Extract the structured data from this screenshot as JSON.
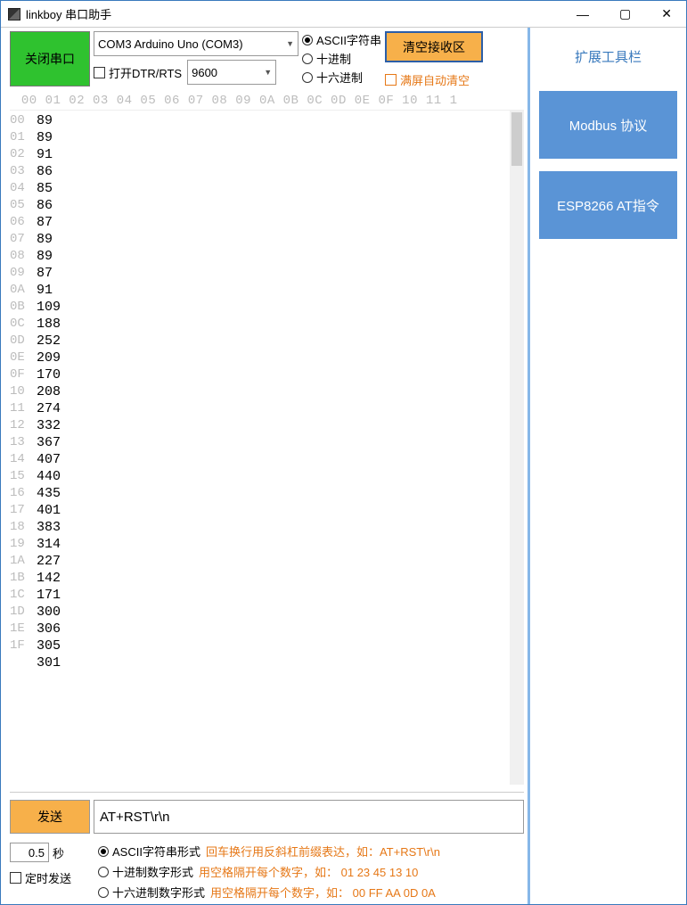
{
  "titlebar": {
    "title": "linkboy 串口助手"
  },
  "toolbar": {
    "close_port": "关闭串口",
    "port_value": "COM3 Arduino Uno (COM3)",
    "open_dtr_rts": "打开DTR/RTS",
    "baud_value": "9600",
    "fmt": {
      "ascii": "ASCII字符串",
      "dec": "十进制",
      "hex": "十六进制"
    },
    "clear_recv": "清空接收区",
    "auto_clear": "满屏自动清空"
  },
  "hex_cols": " 00 01 02 03 04 05 06 07 08 09 0A 0B 0C 0D 0E 0F 10 11 1",
  "row_labels": [
    "00",
    "01",
    "02",
    "03",
    "04",
    "05",
    "06",
    "07",
    "08",
    "09",
    "0A",
    "0B",
    "0C",
    "0D",
    "0E",
    "0F",
    "10",
    "11",
    "12",
    "13",
    "14",
    "15",
    "16",
    "17",
    "18",
    "19",
    "1A",
    "1B",
    "1C",
    "1D",
    "1E",
    "1F"
  ],
  "recv_lines": [
    "89",
    "89",
    "91",
    "86",
    "85",
    "86",
    "87",
    "89",
    "89",
    "87",
    "91",
    "109",
    "188",
    "252",
    "209",
    "170",
    "208",
    "274",
    "332",
    "367",
    "407",
    "440",
    "435",
    "401",
    "383",
    "314",
    "227",
    "142",
    "171",
    "300",
    "306",
    "305",
    "301"
  ],
  "send": {
    "btn": "发送",
    "value": "AT+RST\\r\\n",
    "timer_val": "0.5",
    "timer_unit": "秒",
    "timed_send": "定时发送",
    "fmt_ascii": "ASCII字符串形式",
    "fmt_dec": "十进制数字形式",
    "fmt_hex": "十六进制数字形式",
    "hint_ascii": "回车换行用反斜杠前缀表达，如：AT+RST\\r\\n",
    "hint_dec": "用空格隔开每个数字，如： 01 23 45 13 10",
    "hint_hex": "用空格隔开每个数字，如：  00 FF AA 0D 0A"
  },
  "right": {
    "header": "扩展工具栏",
    "modbus": "Modbus 协议",
    "esp": "ESP8266  AT指令"
  }
}
